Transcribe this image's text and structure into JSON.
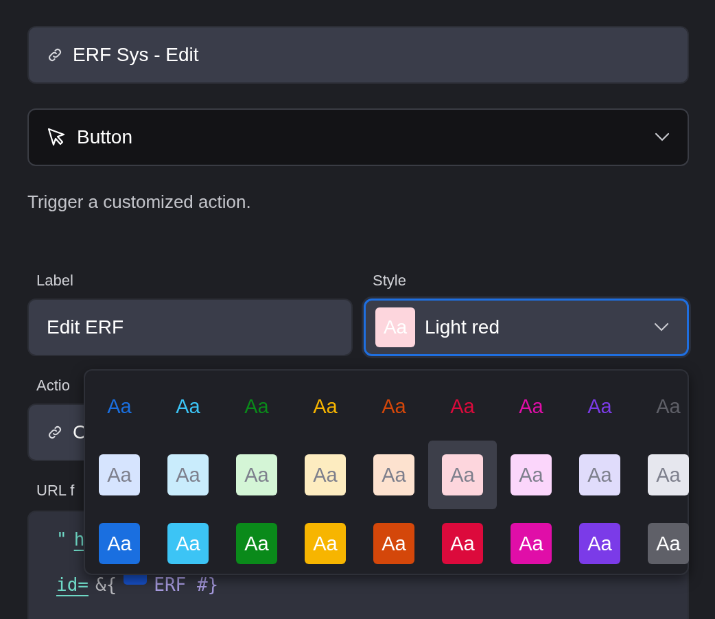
{
  "title_field": {
    "value": "ERF Sys - Edit"
  },
  "type_select": {
    "value": "Button"
  },
  "description": "Trigger a customized action.",
  "label_field": {
    "label": "Label",
    "value": "Edit ERF"
  },
  "style_select": {
    "label": "Style",
    "value": "Light red",
    "swatch": {
      "label": "Aa",
      "color": "#fdd6dd"
    },
    "focused": true
  },
  "action_field": {
    "label": "Actio",
    "value": "C"
  },
  "url_field": {
    "label": "URL f",
    "lines": [
      [
        {
          "kind": "string",
          "text": "\""
        },
        {
          "kind": "link",
          "text": "h"
        }
      ],
      [
        {
          "kind": "link",
          "text": "id="
        },
        {
          "kind": "plain",
          "text": "&{"
        },
        {
          "kind": "token"
        },
        {
          "kind": "var",
          "text": "ERF #}"
        }
      ]
    ]
  },
  "style_menu": {
    "rows": [
      {
        "kind": "text",
        "items": [
          {
            "label": "Aa",
            "color": "#1a6fe0",
            "selected": false
          },
          {
            "label": "Aa",
            "color": "#3cc4f5",
            "selected": false
          },
          {
            "label": "Aa",
            "color": "#0a8a1a",
            "selected": false
          },
          {
            "label": "Aa",
            "color": "#f7b500",
            "selected": false
          },
          {
            "label": "Aa",
            "color": "#d4470a",
            "selected": false
          },
          {
            "label": "Aa",
            "color": "#dc0a3c",
            "selected": false
          },
          {
            "label": "Aa",
            "color": "#e00ea8",
            "selected": false
          },
          {
            "label": "Aa",
            "color": "#7b3be8",
            "selected": false
          },
          {
            "label": "Aa",
            "color": "#5f6068",
            "selected": false
          }
        ]
      },
      {
        "kind": "light",
        "items": [
          {
            "label": "Aa",
            "color": "#d6e4fe",
            "selected": false
          },
          {
            "label": "Aa",
            "color": "#c9ecfc",
            "selected": false
          },
          {
            "label": "Aa",
            "color": "#d4f5d6",
            "selected": false
          },
          {
            "label": "Aa",
            "color": "#fdecc0",
            "selected": false
          },
          {
            "label": "Aa",
            "color": "#fde2cf",
            "selected": false
          },
          {
            "label": "Aa",
            "color": "#fdd6dd",
            "selected": true
          },
          {
            "label": "Aa",
            "color": "#fbd6fb",
            "selected": false
          },
          {
            "label": "Aa",
            "color": "#e0dcfb",
            "selected": false
          },
          {
            "label": "Aa",
            "color": "#e6e7ee",
            "selected": false
          }
        ]
      },
      {
        "kind": "solid",
        "items": [
          {
            "label": "Aa",
            "color": "#1a6fe0",
            "selected": false
          },
          {
            "label": "Aa",
            "color": "#3cc4f5",
            "selected": false
          },
          {
            "label": "Aa",
            "color": "#0a8a1a",
            "selected": false
          },
          {
            "label": "Aa",
            "color": "#f7b500",
            "selected": false
          },
          {
            "label": "Aa",
            "color": "#d4470a",
            "selected": false
          },
          {
            "label": "Aa",
            "color": "#dc0a3c",
            "selected": false
          },
          {
            "label": "Aa",
            "color": "#e00ea8",
            "selected": false
          },
          {
            "label": "Aa",
            "color": "#7b3be8",
            "selected": false
          },
          {
            "label": "Aa",
            "color": "#5f6068",
            "selected": false
          }
        ]
      }
    ]
  }
}
